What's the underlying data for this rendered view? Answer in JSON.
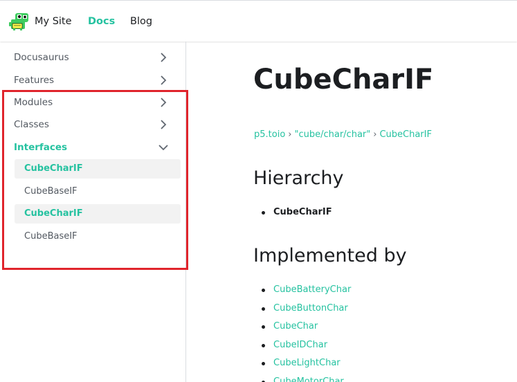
{
  "navbar": {
    "brand_title": "My Site",
    "links": [
      {
        "label": "Docs",
        "active": true
      },
      {
        "label": "Blog",
        "active": false
      }
    ],
    "accent_color": "#25c2a0"
  },
  "sidebar": {
    "categories": [
      {
        "label": "Docusaurus",
        "expanded": false
      },
      {
        "label": "Features",
        "expanded": false
      },
      {
        "label": "Modules",
        "expanded": false
      },
      {
        "label": "Classes",
        "expanded": false
      },
      {
        "label": "Interfaces",
        "expanded": true,
        "active": true
      }
    ],
    "interfaces_items": [
      {
        "label": "CubeCharIF",
        "active": true
      },
      {
        "label": "CubeBaseIF",
        "active": false
      },
      {
        "label": "CubeCharIF",
        "active": true
      },
      {
        "label": "CubeBaseIF",
        "active": false
      }
    ],
    "highlight_color": "#e0242c"
  },
  "main": {
    "title": "CubeCharIF",
    "breadcrumbs": [
      "p5.toio",
      "\"cube/char/char\"",
      "CubeCharIF"
    ],
    "breadcrumb_separator": "›",
    "hierarchy": {
      "heading": "Hierarchy",
      "items": [
        "CubeCharIF"
      ]
    },
    "implemented_by": {
      "heading": "Implemented by",
      "items": [
        "CubeBatteryChar",
        "CubeButtonChar",
        "CubeChar",
        "CubeIDChar",
        "CubeLightChar",
        "CubeMotorChar"
      ]
    }
  }
}
